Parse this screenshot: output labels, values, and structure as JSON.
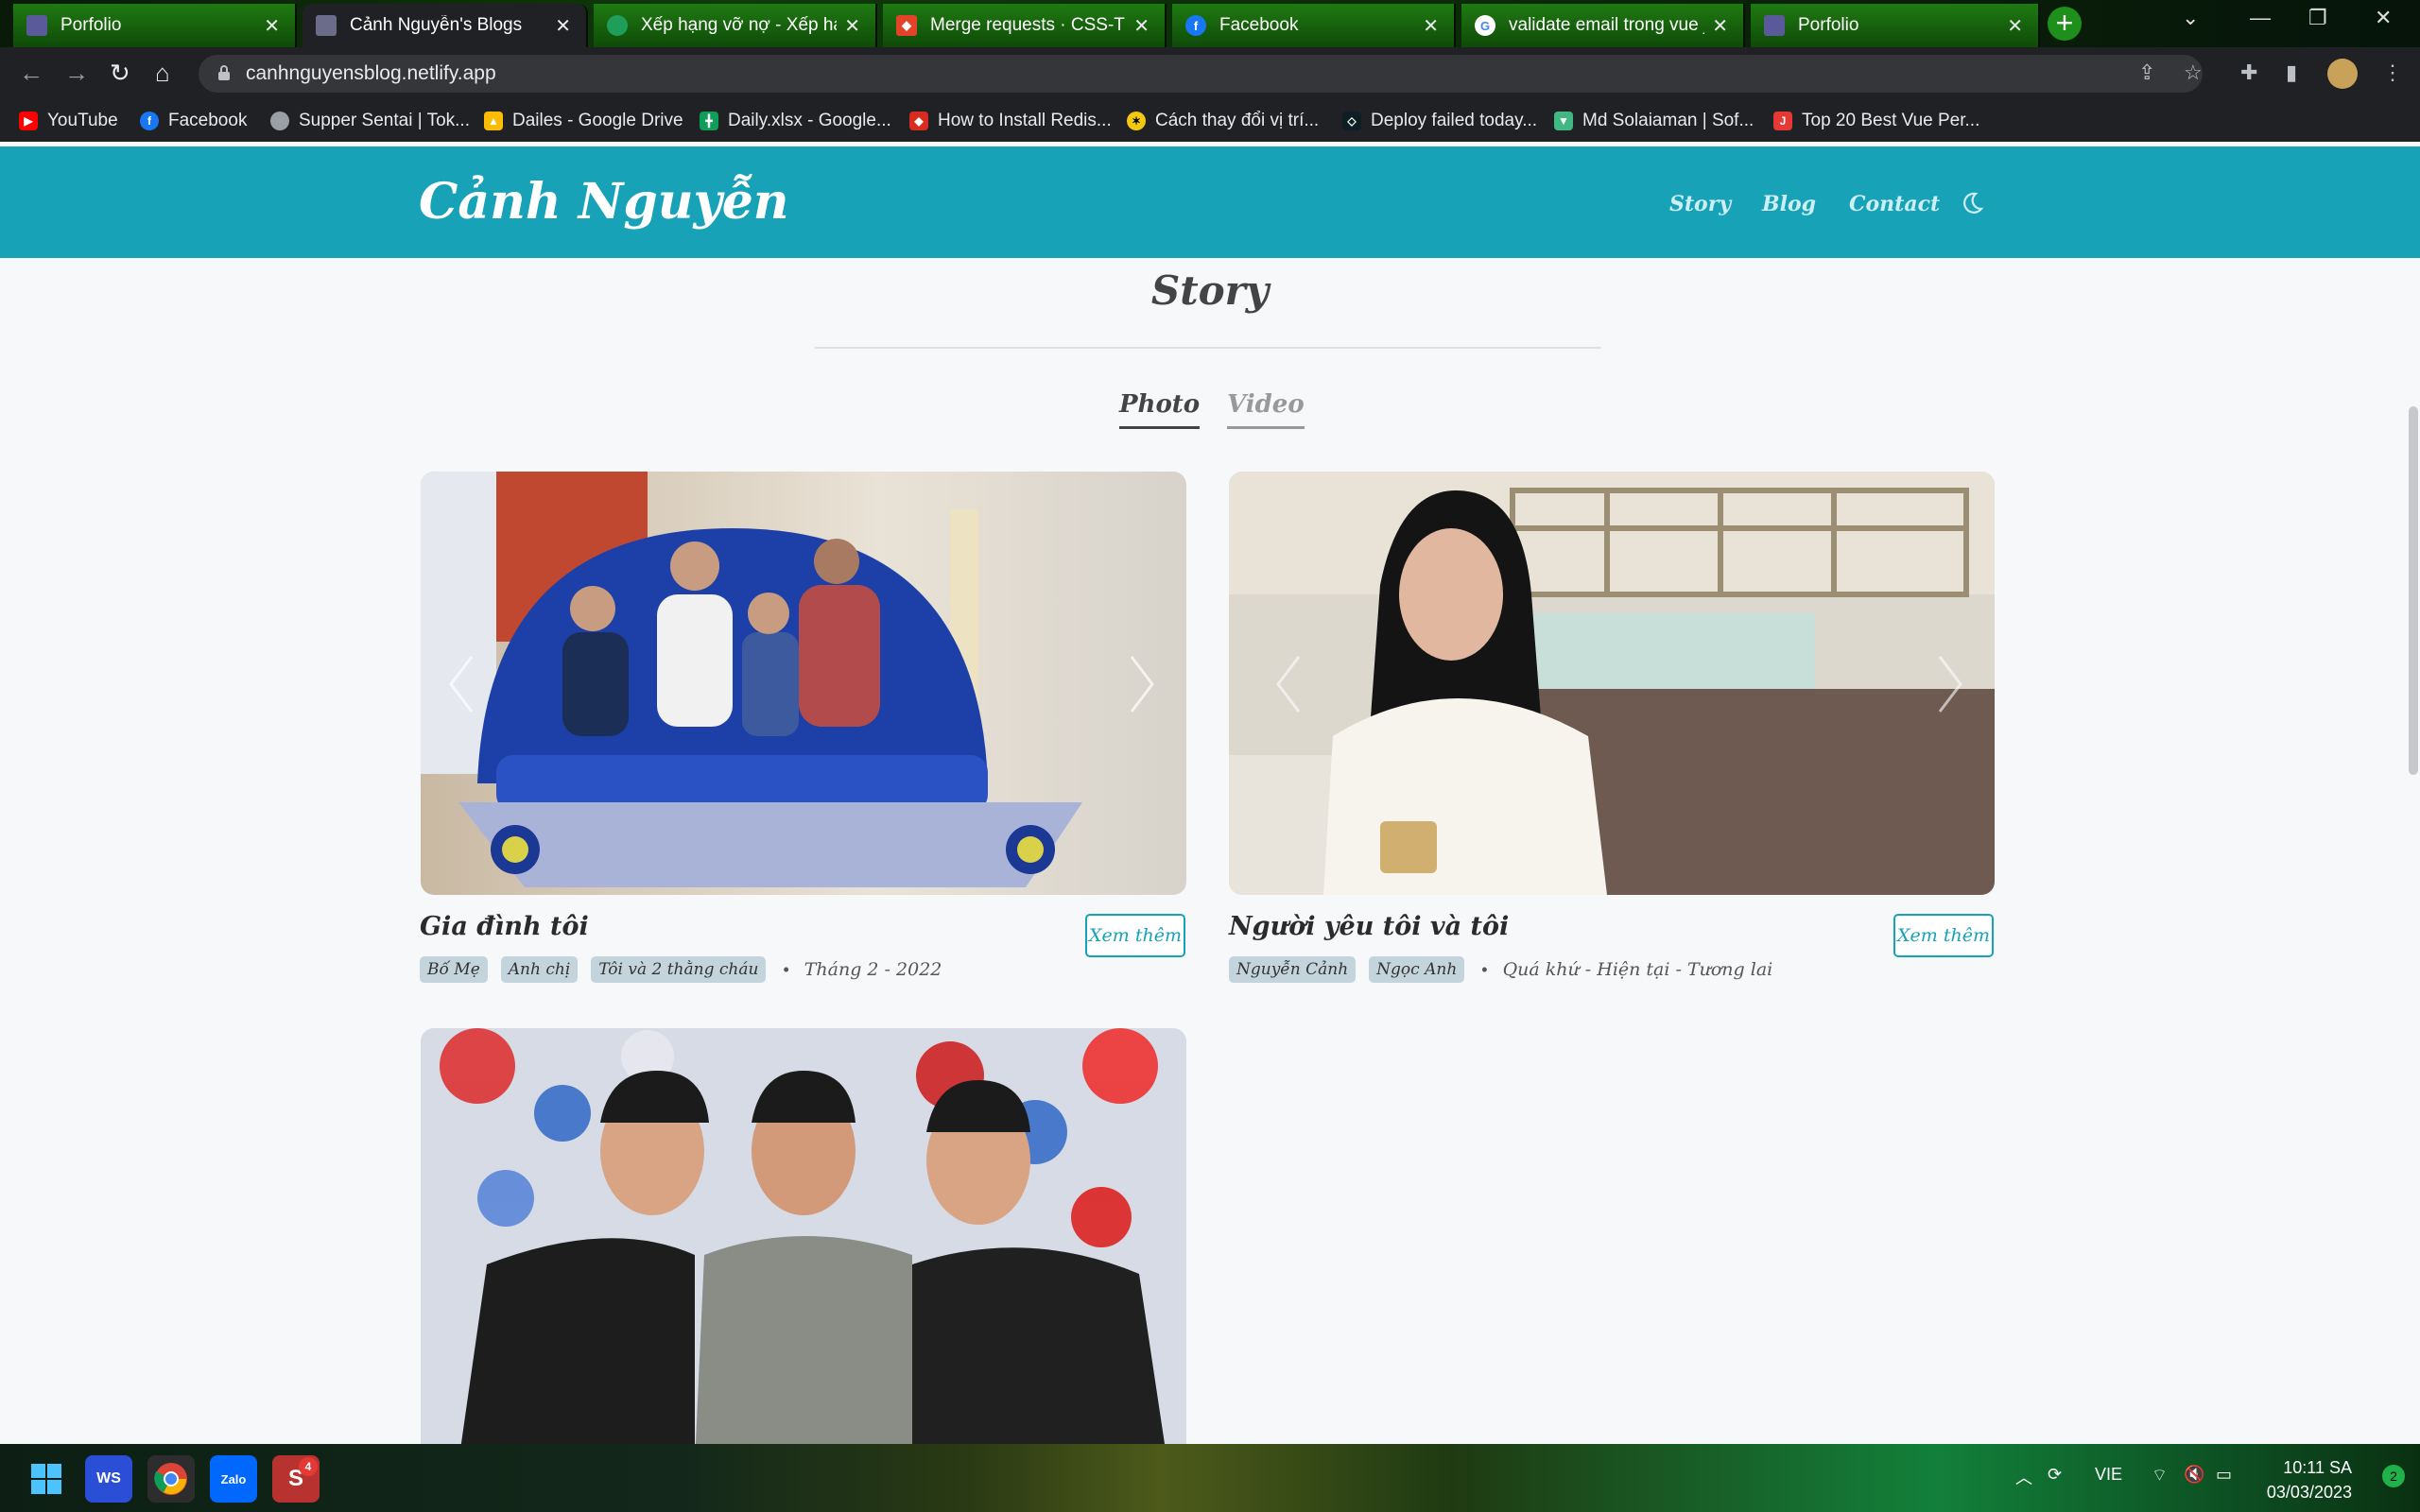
{
  "browser": {
    "tabs": [
      {
        "title": "Porfolio",
        "favicon": "portfolio-favicon",
        "color": "#5a5a9a"
      },
      {
        "title": "Cảnh Nguyễn's Blogs",
        "favicon": "blog-favicon",
        "color": "#6b6b8a"
      },
      {
        "title": "Xếp hạng vỡ nợ - Xếp hạng",
        "favicon": "ranking-favicon",
        "color": "#1f9e5a"
      },
      {
        "title": "Merge requests · CSS-TPB",
        "favicon": "gitlab-icon",
        "color": "#e2432a"
      },
      {
        "title": "Facebook",
        "favicon": "facebook-icon",
        "color": "#1877f2"
      },
      {
        "title": "validate email trong vue js",
        "favicon": "google-icon",
        "color": "#ffffff"
      },
      {
        "title": "Porfolio",
        "favicon": "portfolio-favicon",
        "color": "#5a5a9a"
      }
    ],
    "url": "canhnguyensblog.netlify.app",
    "bookmarks": [
      {
        "label": "YouTube",
        "icon": "youtube-icon",
        "color": "#ff0000"
      },
      {
        "label": "Facebook",
        "icon": "facebook-icon",
        "color": "#1877f2"
      },
      {
        "label": "Supper Sentai | Tok...",
        "icon": "globe-icon",
        "color": "#9aa0a6"
      },
      {
        "label": "Dailes - Google Drive",
        "icon": "drive-icon",
        "color": "#fbbc04"
      },
      {
        "label": "Daily.xlsx - Google...",
        "icon": "sheets-icon",
        "color": "#0f9d58"
      },
      {
        "label": "How to Install Redis...",
        "icon": "redis-icon",
        "color": "#d82c20"
      },
      {
        "label": "Cách thay đổi vị trí...",
        "icon": "site-icon",
        "color": "#f2c811"
      },
      {
        "label": "Deploy failed today...",
        "icon": "netlify-icon",
        "color": "#0e1e25"
      },
      {
        "label": "Md Solaiaman | Sof...",
        "icon": "vue-icon",
        "color": "#41b883"
      },
      {
        "label": "Top 20 Best Vue Per...",
        "icon": "site-icon",
        "color": "#e53935"
      }
    ]
  },
  "site": {
    "brand": "Cảnh Nguyễn",
    "nav": [
      "Story",
      "Blog",
      "Contact"
    ],
    "accent": "#17a2b8"
  },
  "story": {
    "title": "Story",
    "tabs": [
      "Photo",
      "Video"
    ],
    "cards": [
      {
        "title": "Gia đình tôi",
        "button": "Xem thêm",
        "tags": [
          "Bố Mẹ",
          "Anh chị",
          "Tôi và 2 thằng cháu"
        ],
        "date": "Tháng 2 - 2022"
      },
      {
        "title": "Người yêu tôi và tôi",
        "button": "Xem thêm",
        "tags": [
          "Nguyễn Cảnh",
          "Ngọc Anh"
        ],
        "date": "Quá khứ - Hiện tại - Tương lai"
      },
      {
        "title": "",
        "button": "",
        "tags": [],
        "date": ""
      }
    ]
  },
  "taskbar": {
    "language": "VIE",
    "time": "10:11 SA",
    "date": "03/03/2023",
    "notifications": "2",
    "skype_badge": "4"
  }
}
